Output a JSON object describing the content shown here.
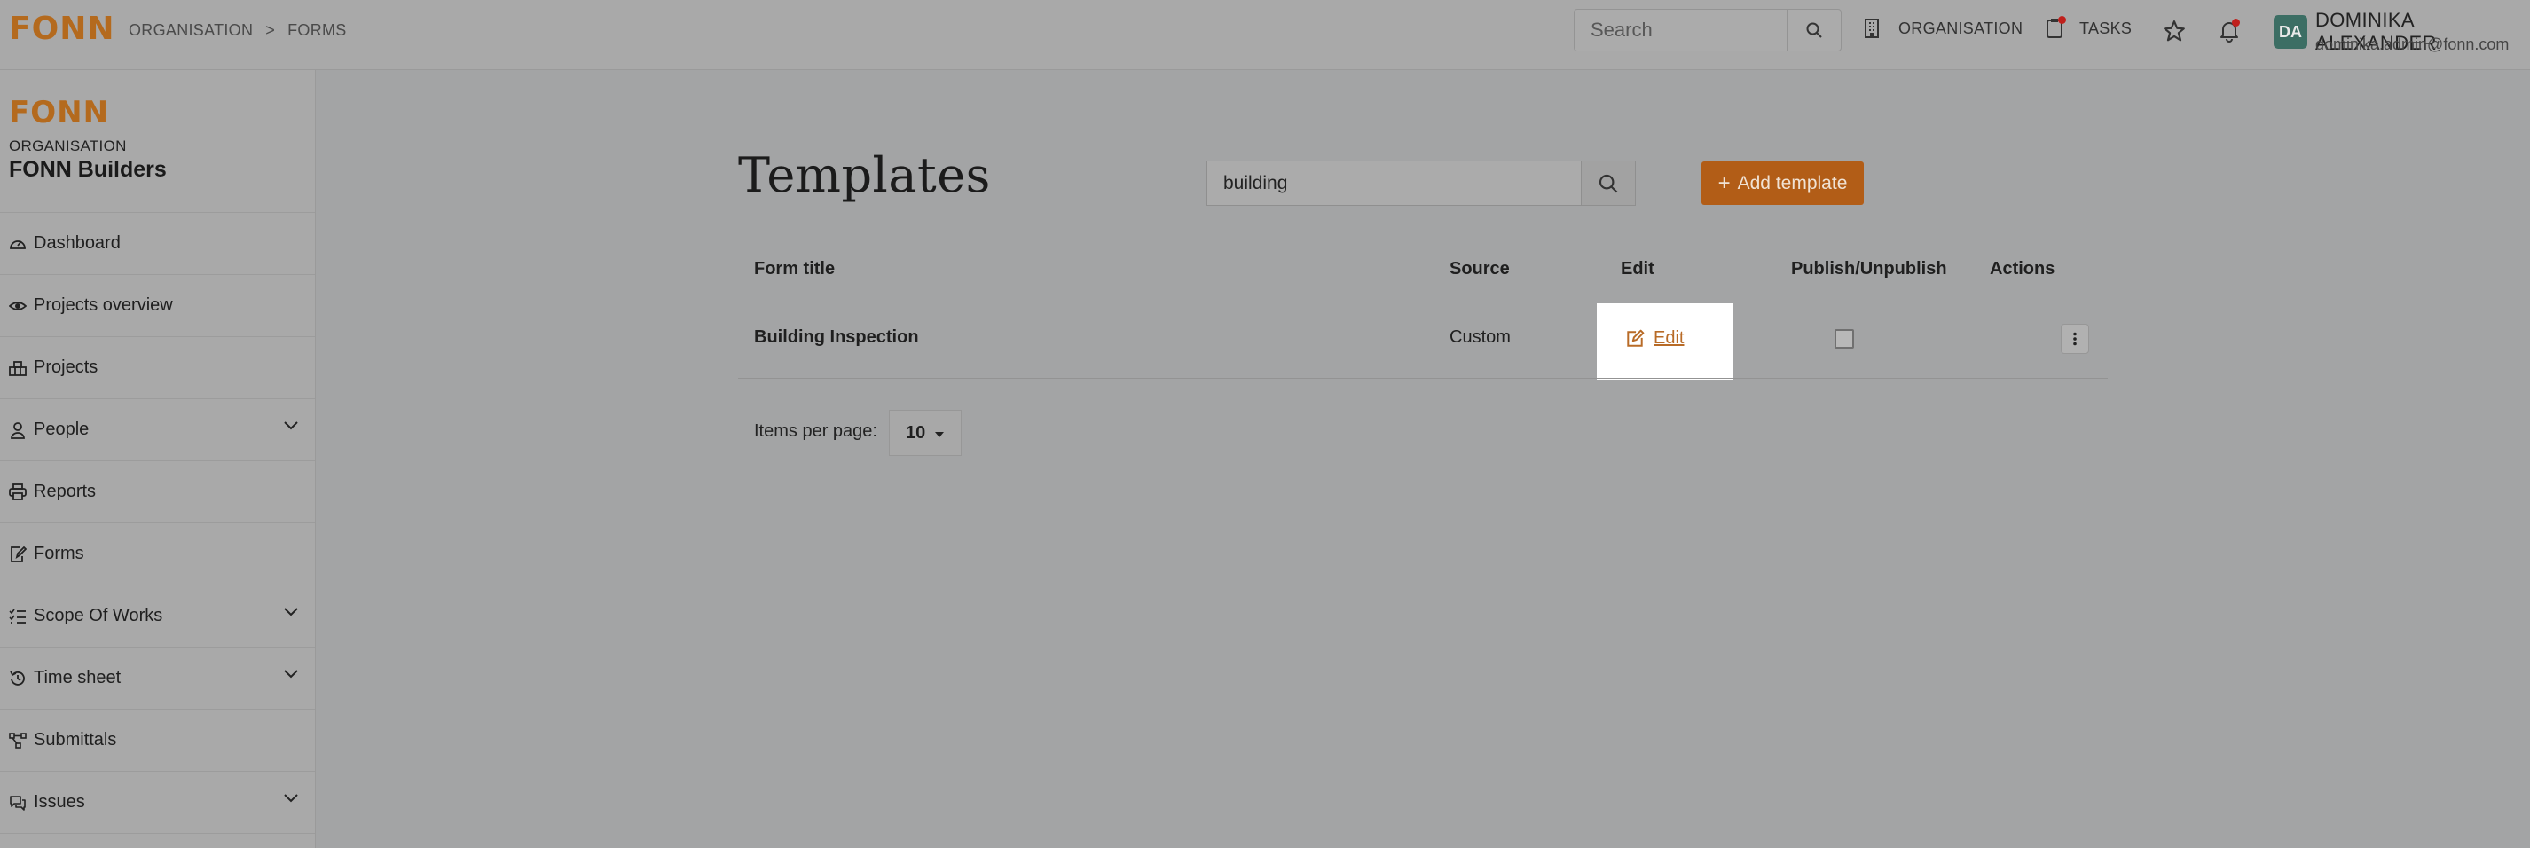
{
  "brand": {
    "logo_text": "FONN"
  },
  "breadcrumb": {
    "items": [
      "ORGANISATION",
      "FORMS"
    ],
    "separator": ">"
  },
  "topbar": {
    "search_placeholder": "Search",
    "organisation_label": "ORGANISATION",
    "tasks_label": "TASKS"
  },
  "user": {
    "initials": "DA",
    "name": "DOMINIKA ALEXANDER",
    "email": "dominika.admin@fonn.com"
  },
  "sidebar": {
    "org_label": "ORGANISATION",
    "org_name": "FONN Builders",
    "items": [
      {
        "label": "Dashboard",
        "icon": "gauge-icon",
        "expandable": false
      },
      {
        "label": "Projects overview",
        "icon": "eye-icon",
        "expandable": false
      },
      {
        "label": "Projects",
        "icon": "projects-icon",
        "expandable": false
      },
      {
        "label": "People",
        "icon": "person-icon",
        "expandable": true
      },
      {
        "label": "Reports",
        "icon": "printer-icon",
        "expandable": false
      },
      {
        "label": "Forms",
        "icon": "form-edit-icon",
        "expandable": false
      },
      {
        "label": "Scope Of Works",
        "icon": "list-icon",
        "expandable": true
      },
      {
        "label": "Time sheet",
        "icon": "history-icon",
        "expandable": true
      },
      {
        "label": "Submittals",
        "icon": "flow-icon",
        "expandable": false
      },
      {
        "label": "Issues",
        "icon": "chat-icon",
        "expandable": true
      }
    ]
  },
  "main": {
    "title": "Templates",
    "search_value": "building",
    "add_button_label": "Add template",
    "table": {
      "headers": [
        "Form title",
        "Source",
        "Edit",
        "Publish/Unpublish",
        "Actions"
      ],
      "rows": [
        {
          "title": "Building Inspection",
          "source": "Custom",
          "edit_label": "Edit",
          "published": false
        }
      ]
    },
    "pagination": {
      "items_per_page_label": "Items per page:",
      "items_per_page_value": "10"
    }
  },
  "colors": {
    "accent": "#b25d17",
    "link": "#b86b27",
    "avatar": "#3c6e64",
    "notification_dot": "#c0201c"
  }
}
